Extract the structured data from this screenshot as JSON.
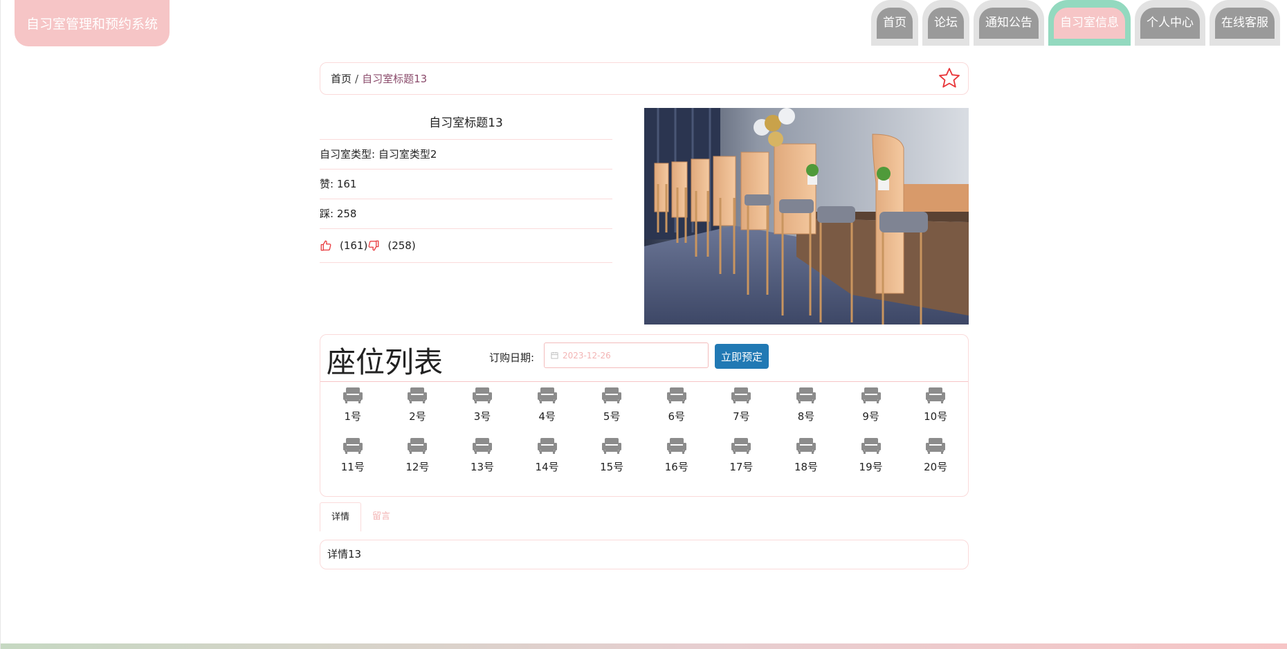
{
  "header": {
    "brand": "自习室管理和预约系统",
    "nav": [
      {
        "label": "首页",
        "active": false
      },
      {
        "label": "论坛",
        "active": false
      },
      {
        "label": "通知公告",
        "active": false
      },
      {
        "label": "自习室信息",
        "active": true
      },
      {
        "label": "个人中心",
        "active": false
      },
      {
        "label": "在线客服",
        "active": false
      }
    ]
  },
  "breadcrumb": {
    "home": "首页",
    "separator": "/",
    "current": "自习室标题13",
    "favorite_icon": "star-outline-icon"
  },
  "info": {
    "title": "自习室标题13",
    "type_label": "自习室类型: 自习室类型2",
    "likes_label": "赞: 161",
    "dislikes_label": "踩: 258",
    "like_count": "(161)",
    "dislike_count": "(258)",
    "like_icon": "thumbs-up-icon",
    "dislike_icon": "thumbs-down-icon"
  },
  "seats": {
    "title": "座位列表",
    "date_label": "订购日期:",
    "date_placeholder": "2023-12-26",
    "book_button": "立即预定",
    "seat_icon": "armchair-icon",
    "items": [
      "1号",
      "2号",
      "3号",
      "4号",
      "5号",
      "6号",
      "7号",
      "8号",
      "9号",
      "10号",
      "11号",
      "12号",
      "13号",
      "14号",
      "15号",
      "16号",
      "17号",
      "18号",
      "19号",
      "20号"
    ]
  },
  "tabs": [
    {
      "label": "详情",
      "active": true
    },
    {
      "label": "留言",
      "active": false
    }
  ],
  "detail": "详情13",
  "colors": {
    "brand_pink": "#f6c5c6",
    "active_nav_green": "#93d9bf",
    "nav_gray": "#9a9a9a",
    "button_blue": "#2179b4",
    "accent_red": "#e8363a"
  }
}
